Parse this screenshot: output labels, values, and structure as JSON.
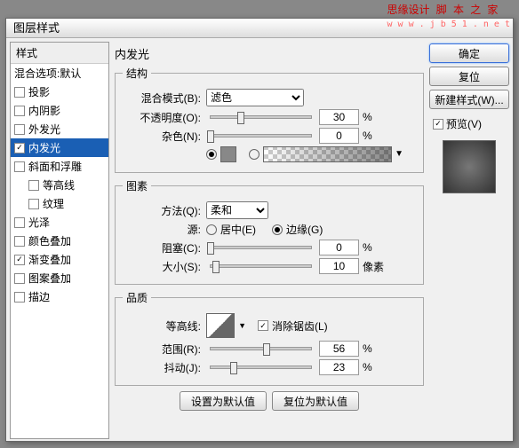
{
  "watermark": {
    "main": "思缘设计 脚 本 之 家",
    "sub": "w w w . j b 5 1 . n e t"
  },
  "dialog_title": "图层样式",
  "sidebar": {
    "header": "样式",
    "blend_options": "混合选项:默认",
    "drop_shadow": "投影",
    "inner_shadow": "内阴影",
    "outer_glow": "外发光",
    "inner_glow": "内发光",
    "bevel": "斜面和浮雕",
    "contour": "等高线",
    "texture": "纹理",
    "satin": "光泽",
    "color_overlay": "颜色叠加",
    "gradient_overlay": "渐变叠加",
    "pattern_overlay": "图案叠加",
    "stroke": "描边"
  },
  "panel": {
    "title": "内发光",
    "structure": {
      "legend": "结构",
      "blend_mode_label": "混合模式(B):",
      "blend_mode_value": "滤色",
      "opacity_label": "不透明度(O):",
      "opacity_value": "30",
      "noise_label": "杂色(N):",
      "noise_value": "0",
      "pct": "%"
    },
    "elements": {
      "legend": "图素",
      "method_label": "方法(Q):",
      "method_value": "柔和",
      "source_label": "源:",
      "center": "居中(E)",
      "edge": "边缘(G)",
      "choke_label": "阻塞(C):",
      "choke_value": "0",
      "size_label": "大小(S):",
      "size_value": "10",
      "px": "像素",
      "pct": "%"
    },
    "quality": {
      "legend": "品质",
      "contour_label": "等高线:",
      "antialias": "消除锯齿(L)",
      "range_label": "范围(R):",
      "range_value": "56",
      "jitter_label": "抖动(J):",
      "jitter_value": "23",
      "pct": "%"
    },
    "set_default": "设置为默认值",
    "reset_default": "复位为默认值"
  },
  "right": {
    "ok": "确定",
    "reset": "复位",
    "new_style": "新建样式(W)...",
    "preview": "预览(V)"
  }
}
